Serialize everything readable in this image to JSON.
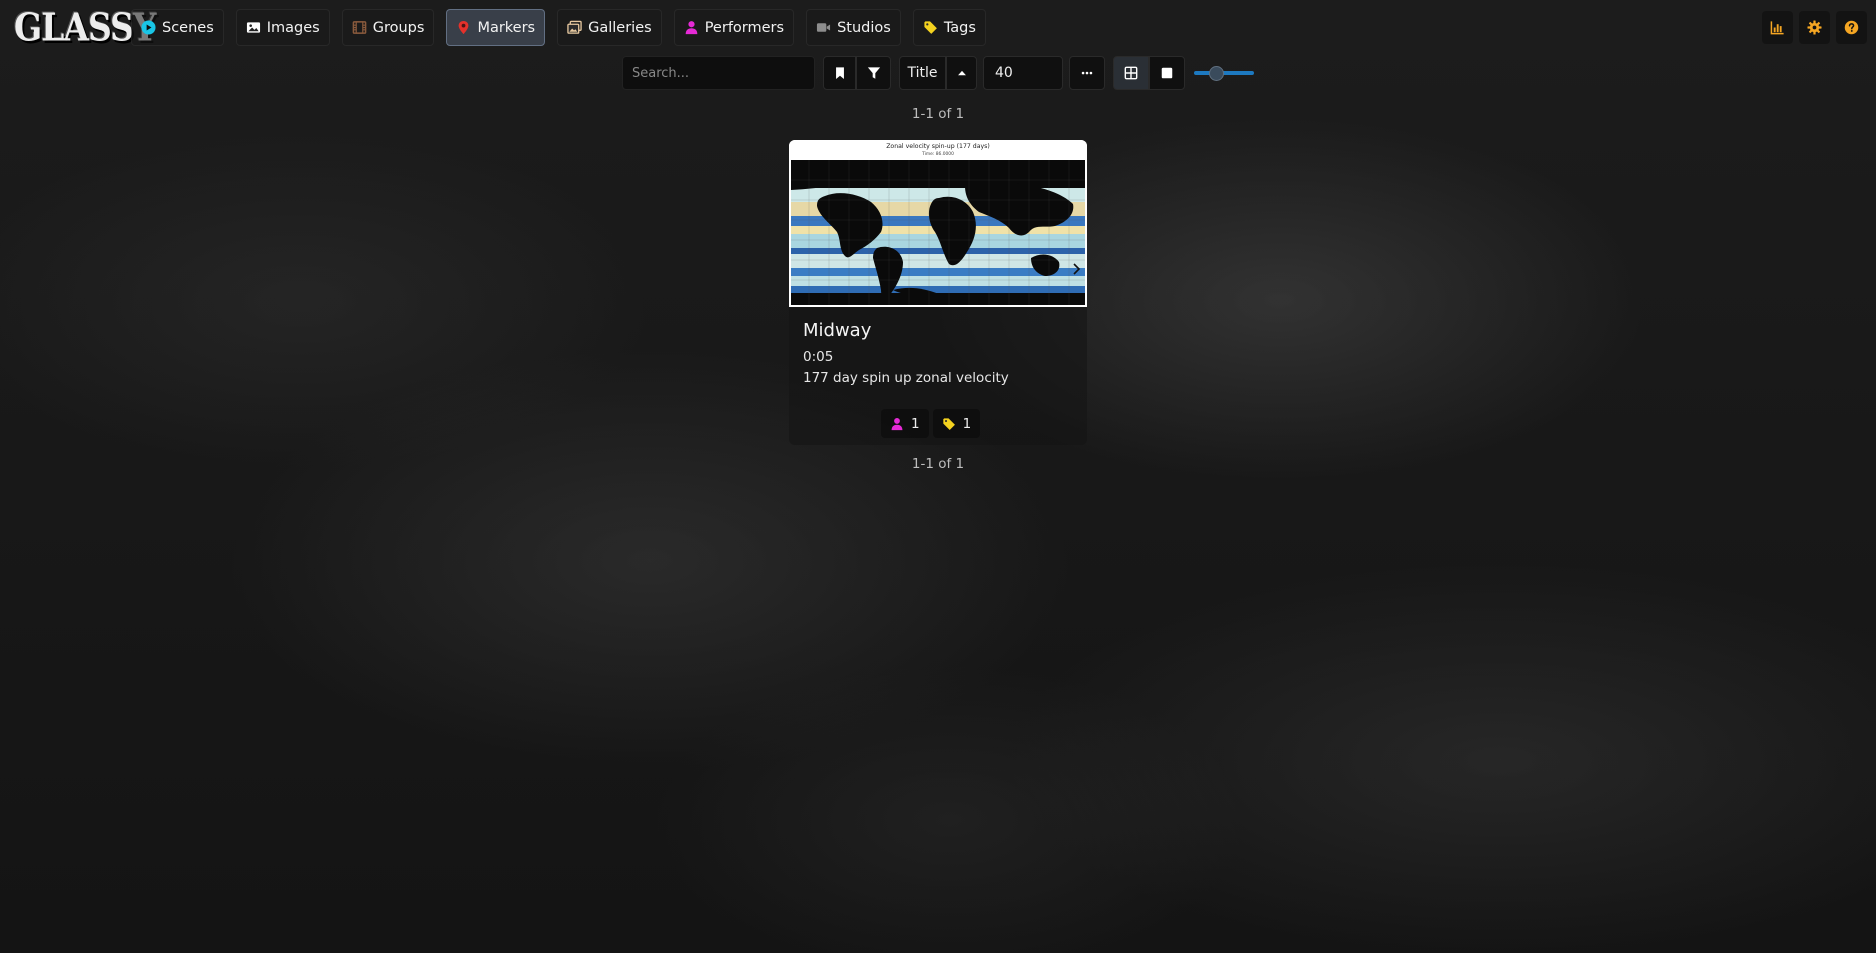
{
  "brand": "GLASSY",
  "nav": {
    "items": [
      {
        "key": "scenes",
        "label": "Scenes",
        "icon": "play-circle-icon",
        "color": "#19c5e6",
        "active": false
      },
      {
        "key": "images",
        "label": "Images",
        "icon": "image-icon",
        "color": "#ffffff",
        "active": false
      },
      {
        "key": "groups",
        "label": "Groups",
        "icon": "film-icon",
        "color": "#8a5a3c",
        "active": false
      },
      {
        "key": "markers",
        "label": "Markers",
        "icon": "map-marker-icon",
        "color": "#e4312b",
        "active": true
      },
      {
        "key": "galleries",
        "label": "Galleries",
        "icon": "images-icon",
        "color": "#e8c9a0",
        "active": false
      },
      {
        "key": "performers",
        "label": "Performers",
        "icon": "user-icon",
        "color": "#e62ad6",
        "active": false
      },
      {
        "key": "studios",
        "label": "Studios",
        "icon": "video-icon",
        "color": "#8d8d8d",
        "active": false
      },
      {
        "key": "tags",
        "label": "Tags",
        "icon": "tag-icon",
        "color": "#f4d21f",
        "active": false
      }
    ],
    "right": [
      {
        "icon": "chart-bar-icon",
        "color": "#f5a623"
      },
      {
        "icon": "gear-icon",
        "color": "#f5a623"
      },
      {
        "icon": "help-icon",
        "color": "#f5a623"
      }
    ]
  },
  "toolbar": {
    "search_placeholder": "Search...",
    "sort_label": "Title",
    "per_page": "40",
    "zoom_level": 0.33
  },
  "pagination": {
    "top": "1-1 of 1",
    "bottom": "1-1 of 1"
  },
  "card": {
    "title": "Midway",
    "time": "0:05",
    "description": "177 day spin up zonal velocity",
    "thumb_title": "Zonal velocity spin-up (177 days)",
    "thumb_subtitle": "Time: 86.0000",
    "performers_count": "1",
    "tags_count": "1"
  },
  "colors": {
    "accent_blue": "#1d79c0",
    "nav_active_bg": "#464e5c",
    "right_icons": "#f5a623"
  }
}
